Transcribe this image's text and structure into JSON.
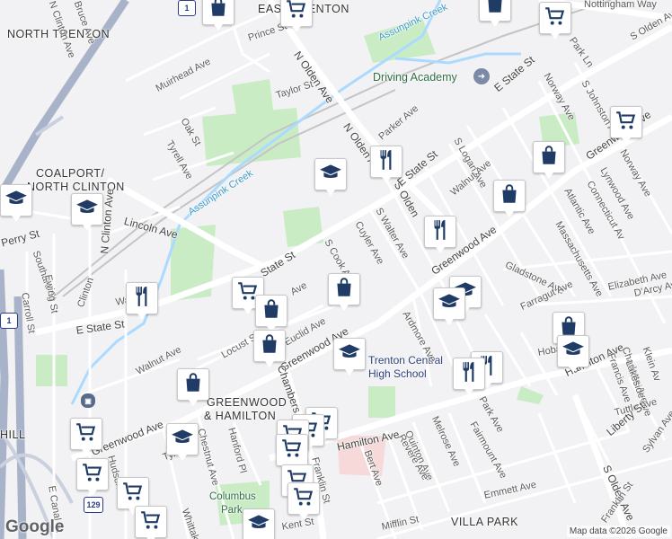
{
  "map": {
    "google_logo": "Google",
    "attribution": "Map data ©2026 Google",
    "route_shields": [
      "1",
      "1",
      "129"
    ],
    "colors": {
      "background": "#f2f2f4",
      "road": "#ffffff",
      "major_road": "#ffffff",
      "park": "#c9ecc5",
      "water": "#aadaff",
      "school": "#f3ecf8",
      "highway": "#a8b3c9",
      "pin_icon": "#1f3b66"
    },
    "areas": [
      {
        "name": "neighborhood-east-trenton",
        "text": "EAST TRENTON"
      },
      {
        "name": "neighborhood-north-trenton",
        "text": "NORTH TRENTON"
      },
      {
        "name": "neighborhood-coalport",
        "text": "COALPORT/"
      },
      {
        "name": "neighborhood-north-clinton",
        "text": "NORTH CLINTON"
      },
      {
        "name": "neighborhood-greenwood-hamilton-1",
        "text": "GREENWOOD"
      },
      {
        "name": "neighborhood-greenwood-hamilton-2",
        "text": "& HAMILTON"
      },
      {
        "name": "neighborhood-villa-park",
        "text": "VILLA PARK"
      },
      {
        "name": "neighborhood-hill",
        "text": "HILL"
      }
    ],
    "places": [
      {
        "name": "place-driving-academy",
        "text": "Driving Academy"
      },
      {
        "name": "place-trenton-central-1",
        "text": "Trenton Central"
      },
      {
        "name": "place-trenton-central-2",
        "text": "High School"
      },
      {
        "name": "place-columbus-park-1",
        "text": "Columbus"
      },
      {
        "name": "place-columbus-park-2",
        "text": "Park"
      }
    ],
    "water": [
      {
        "name": "water-assunpink-creek-1",
        "text": "Assunpink Creek"
      },
      {
        "name": "water-assunpink-creek-2",
        "text": "Assunpink Creek"
      }
    ],
    "streets": [
      "Nottingham Way",
      "Prince St",
      "Park Ln",
      "S Olden Ave",
      "Muirhead Ave",
      "Taylor St",
      "N Olden Ave",
      "E State St",
      "Norway Ave",
      "S Johnston Ave",
      "Oak St",
      "Tyrell Ave",
      "Parker Ave",
      "N Olden Ave",
      "S Logan Ave",
      "Greenwood Ave",
      "Lynwood Ave",
      "Norway Ave",
      "Connecticut Av",
      "Atlantic Ave",
      "Walnut Ave",
      "S Olden",
      "E State St",
      "Massachusetts Ave",
      "Perry St",
      "Lincoln Ave",
      "Southard St",
      "N Clinton Ave",
      "Ewing St",
      "Carroll St",
      "Cuyler Ave",
      "S Walter Ave",
      "Greenwood Ave",
      "Gladstone Ave",
      "Elizabeth Ave",
      "D'Arcy Av",
      "State St",
      "S Cook Ave",
      "Farragut Ave",
      "E State St",
      "Clinton",
      "Wall",
      "Locust St",
      "Ave",
      "Euclid Ave",
      "Ardmore Ave",
      "Walnut Ave",
      "Greenwood Ave",
      "Chambers St",
      "Hoba",
      "Hamilton Ave",
      "Klein Av",
      "Charlotte Ave",
      "Francis Ave",
      "Lakeside Ave",
      "Park Ave",
      "Tuttle Ave",
      "Liberty St",
      "Fairmount Ave",
      "Melrose Ave",
      "Quinton Ave",
      "Revere Ave",
      "Greenwood Ave",
      "Hamilton Ave",
      "Hudson St",
      "Chestnut Ave",
      "Tyler St",
      "Hanford Pl",
      "Bert Ave",
      "Franklin St",
      "E Canal St",
      "Whittaker",
      "Kent St",
      "Mifflin St",
      "Emmett Ave",
      "S Olden Ave",
      "Sylvan Ave",
      "Franklin St",
      "Bruce Ave",
      "N Clinton Ave"
    ],
    "markers": [
      {
        "name": "shopping-bag-marker",
        "icon": "shopping-bag-icon"
      },
      {
        "name": "shopping-cart-marker",
        "icon": "shopping-cart-icon"
      },
      {
        "name": "restaurant-marker",
        "icon": "restaurant-icon"
      },
      {
        "name": "school-marker",
        "icon": "school-icon"
      }
    ]
  }
}
